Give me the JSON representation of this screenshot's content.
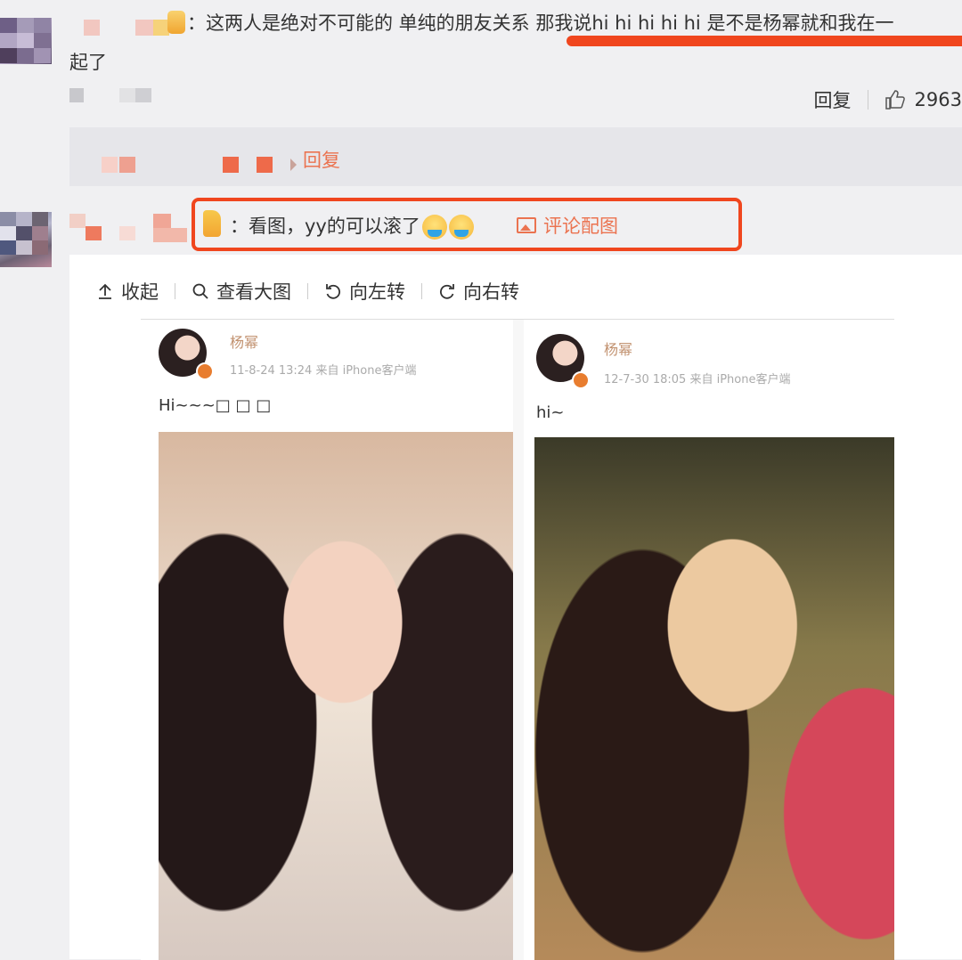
{
  "comment1": {
    "text": "：这两人是绝对不可能的 单纯的朋友关系 那我说hi hi hi hi hi 是不是杨幂就和我在一",
    "text_wrap": "起了",
    "reply_label": "回复",
    "like_count": "2963"
  },
  "sub_reply": {
    "reply_label": "回复"
  },
  "comment2": {
    "text": "：看图，yy的可以滚了",
    "pic_label": "评论配图"
  },
  "viewer": {
    "toolbar": [
      "收起",
      "查看大图",
      "向左转",
      "向右转"
    ]
  },
  "collage": {
    "left": {
      "name": "杨幂",
      "meta": "11-8-24 13:24  来自 iPhone客户端",
      "text": "Hi~~~□ □ □"
    },
    "right": {
      "name": "杨幂",
      "meta": "12-7-30 18:05  来自 iPhone客户端",
      "text": "hi~"
    }
  },
  "colors": {
    "accent": "#eb7350",
    "highlight": "#f0461e"
  }
}
